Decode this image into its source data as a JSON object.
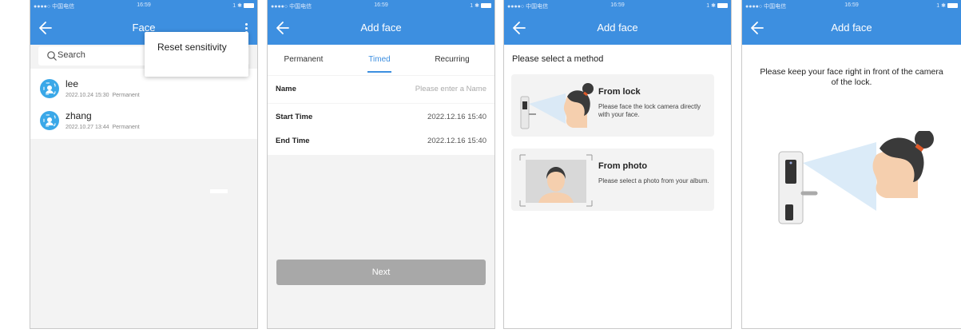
{
  "status_bar": {
    "carrier": "●●●●○ 中国电信 ",
    "time": "16:59",
    "right": "1 ✱"
  },
  "screen1": {
    "title": "Face",
    "search_placeholder": "Search",
    "menu": {
      "reset_label": "Reset sensitivity"
    },
    "users": [
      {
        "name": "lee",
        "date": "2022.10.24 15:30",
        "type": "Permanent"
      },
      {
        "name": "zhang",
        "date": "2022.10.27 13:44",
        "type": "Permanent"
      }
    ]
  },
  "screen2": {
    "title": "Add face",
    "tabs": [
      {
        "label": "Permanent",
        "active": false
      },
      {
        "label": "Timed",
        "active": true
      },
      {
        "label": "Recurring",
        "active": false
      }
    ],
    "fields": [
      {
        "label": "Name",
        "value": "Please enter a Name",
        "placeholder": true
      },
      {
        "label": "Start Time",
        "value": "2022.12.16 15:40"
      },
      {
        "label": "End Time",
        "value": "2022.12.16 15:40"
      }
    ],
    "next_label": "Next"
  },
  "screen3": {
    "title": "Add face",
    "prompt": "Please select a method",
    "methods": [
      {
        "title": "From lock",
        "desc": "Please face the lock camera directly with your face."
      },
      {
        "title": "From photo",
        "desc": "Please select a photo from your album."
      }
    ]
  },
  "screen4": {
    "title": "Add face",
    "instruction": "Please keep your face right in front of the camera of the lock."
  },
  "colors": {
    "accent": "#3d8fe0",
    "avatar": "#3aa8e8",
    "hair": "#3a3a3a",
    "bun_tie": "#e05a2a",
    "skin": "#f5cfae"
  }
}
